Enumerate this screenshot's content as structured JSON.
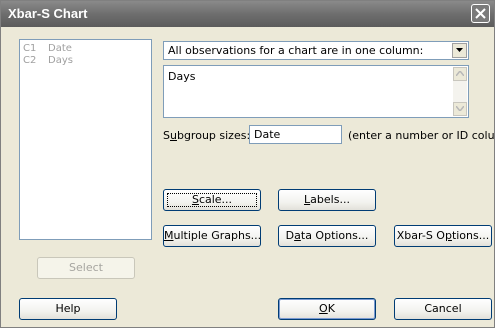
{
  "window": {
    "title": "Xbar-S Chart"
  },
  "variables": [
    {
      "id": "C1",
      "name": "Date"
    },
    {
      "id": "C2",
      "name": "Days"
    }
  ],
  "layout_combo": {
    "selected": "All observations for a chart are in one column:"
  },
  "columns_box": {
    "value": "Days"
  },
  "subgroup": {
    "label_prefix": "S",
    "label_ul": "u",
    "label_rest": "bgroup sizes:",
    "value": "Date",
    "hint": "(enter a number or ID column)"
  },
  "buttons": {
    "scale": {
      "ul": "S",
      "rest": "cale..."
    },
    "labels": {
      "ul": "L",
      "rest": "abels..."
    },
    "multiple_graphs": {
      "ul": "M",
      "rest": "ultiple Graphs..."
    },
    "data_options": {
      "pre": "D",
      "ul": "a",
      "rest": "ta Options..."
    },
    "xbar_s_options": {
      "pre": "Xbar-S O",
      "ul": "p",
      "rest": "tions..."
    },
    "select": "Select",
    "help": "Help",
    "ok": {
      "ul": "O",
      "rest": "K"
    },
    "cancel": "Cancel"
  }
}
